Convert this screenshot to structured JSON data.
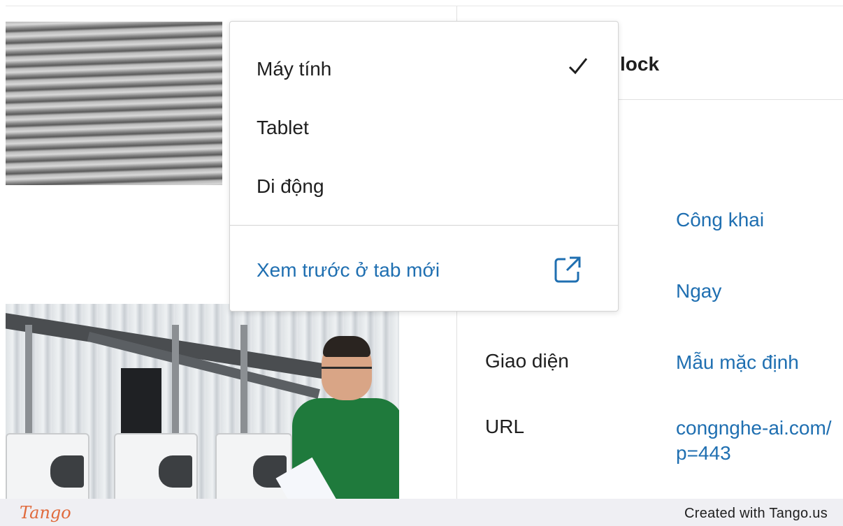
{
  "settings": {
    "title_fragment": "lock",
    "rows": [
      {
        "label": "",
        "value": "Công khai"
      },
      {
        "label": "",
        "value": "Ngay"
      },
      {
        "label": "Giao diện",
        "value": "Mẫu mặc định"
      },
      {
        "label": "URL",
        "value": "congnghe-ai.com/\np=443"
      }
    ]
  },
  "preview_menu": {
    "items": [
      {
        "label": "Máy tính",
        "selected": true
      },
      {
        "label": "Tablet",
        "selected": false
      },
      {
        "label": "Di động",
        "selected": false
      }
    ],
    "open_new_tab_label": "Xem trước ở tab mới",
    "icons": {
      "check": "check-icon",
      "external": "external-link-icon"
    }
  },
  "footer": {
    "brand": "Tango",
    "credit": "Created with Tango.us"
  },
  "colors": {
    "link": "#1f6fb1",
    "brand": "#e06a3c",
    "footer_bg": "#efeff3"
  }
}
